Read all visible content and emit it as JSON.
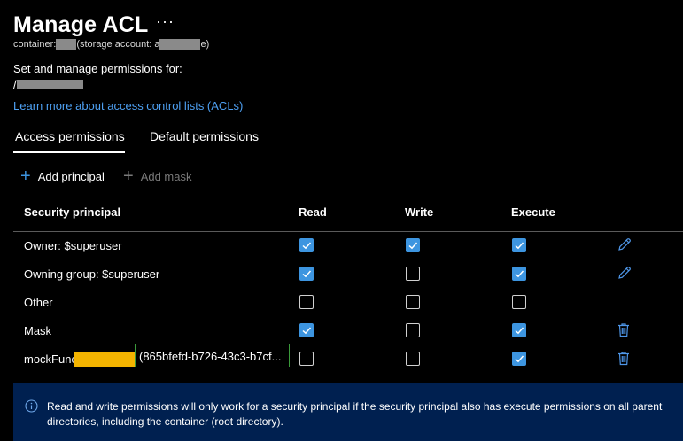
{
  "header": {
    "title": "Manage ACL",
    "more_label": "···",
    "sub_prefix": "container: ",
    "sub_middle": "(storage account: a",
    "sub_suffix": "e)"
  },
  "permissions_for_label": "Set and manage permissions for:",
  "path_prefix": "/",
  "learn_link": "Learn more about access control lists (ACLs)",
  "tabs": [
    {
      "label": "Access permissions",
      "active": true
    },
    {
      "label": "Default permissions",
      "active": false
    }
  ],
  "toolbar": {
    "add_principal": "Add principal",
    "add_mask": "Add mask"
  },
  "table": {
    "headers": [
      "Security principal",
      "Read",
      "Write",
      "Execute"
    ],
    "rows": [
      {
        "principal": "Owner: $superuser",
        "read": true,
        "write": true,
        "execute": true,
        "action": "edit-icon"
      },
      {
        "principal": "Owning group: $superuser",
        "read": true,
        "write": false,
        "execute": true,
        "action": "edit-icon"
      },
      {
        "principal": "Other",
        "read": false,
        "write": false,
        "execute": false,
        "action": ""
      },
      {
        "principal": "Mask",
        "read": true,
        "write": false,
        "execute": true,
        "action": "delete-icon"
      },
      {
        "principal": "mockFunc",
        "id_value": "(865bfefd-b726-43c3-b7cf...",
        "read": false,
        "write": false,
        "execute": true,
        "action": "delete-icon"
      }
    ]
  },
  "info_banner": {
    "text": "Read and write permissions will only work for a security principal if the security principal also has execute permissions on all parent directories, including the container (root directory)."
  },
  "colors": {
    "background": "#000000",
    "accent": "#3d95e0",
    "link": "#4ea0f2",
    "banner": "#002050",
    "highlight": "#f4b400",
    "focus_border": "#3b9a3b"
  }
}
